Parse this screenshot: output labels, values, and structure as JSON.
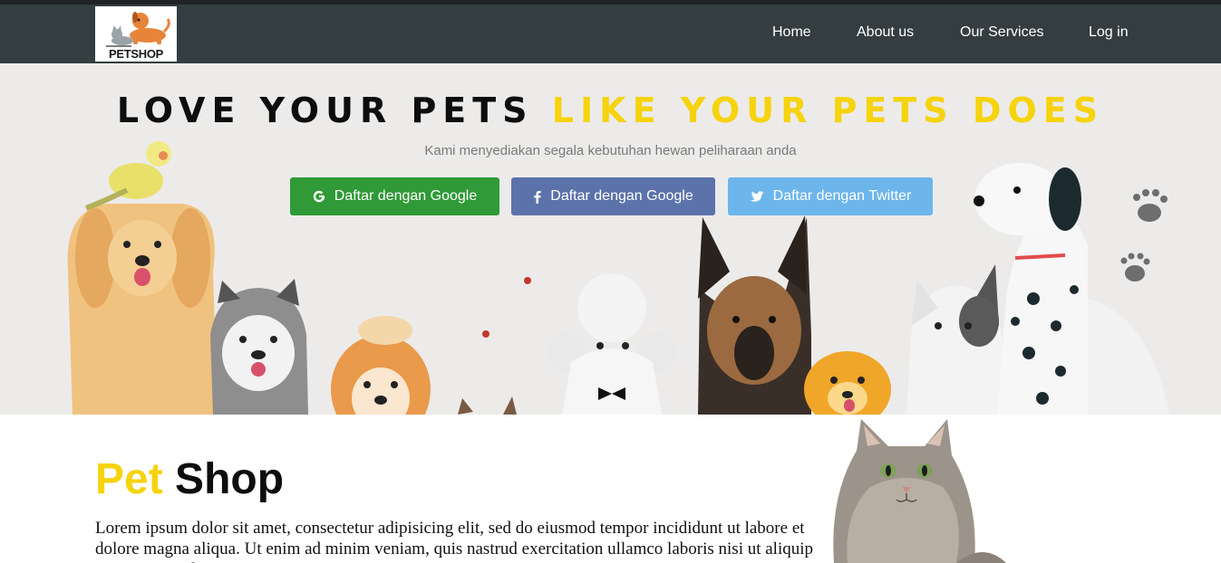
{
  "navbar": {
    "logo_text": "PETSHOP",
    "links": [
      {
        "label": "Home"
      },
      {
        "label": "About us"
      },
      {
        "label": "Our Services"
      },
      {
        "label": "Log in"
      }
    ]
  },
  "hero": {
    "title_part1": "LOVE YOUR PETS",
    "title_part2": "LIKE YOUR PETS DOES",
    "subtitle": "Kami menyediakan segala kebutuhan hewan peliharaan anda",
    "buttons": [
      {
        "label": "Daftar dengan Google",
        "icon": "google-icon",
        "color": "#2f9a37"
      },
      {
        "label": "Daftar dengan Google",
        "icon": "facebook-icon",
        "color": "#5c72aa"
      },
      {
        "label": "Daftar dengan Twitter",
        "icon": "twitter-icon",
        "color": "#6cb6ec"
      }
    ]
  },
  "about": {
    "title_word1": "Pet",
    "title_word2": "Shop",
    "paragraph": "Lorem ipsum dolor sit amet, consectetur adipisicing elit, sed do eiusmod tempor incididunt ut labore et dolore magna aliqua. Ut enim ad minim veniam, quis nastrud exercitation ullamco laboris nisi ut aliquip ex ea commodo consequat."
  },
  "colors": {
    "navbar": "#343d40",
    "accent_yellow": "#f6d30c",
    "google_green": "#2f9a37",
    "facebook_blue": "#5c72aa",
    "twitter_blue": "#6cb6ec"
  }
}
